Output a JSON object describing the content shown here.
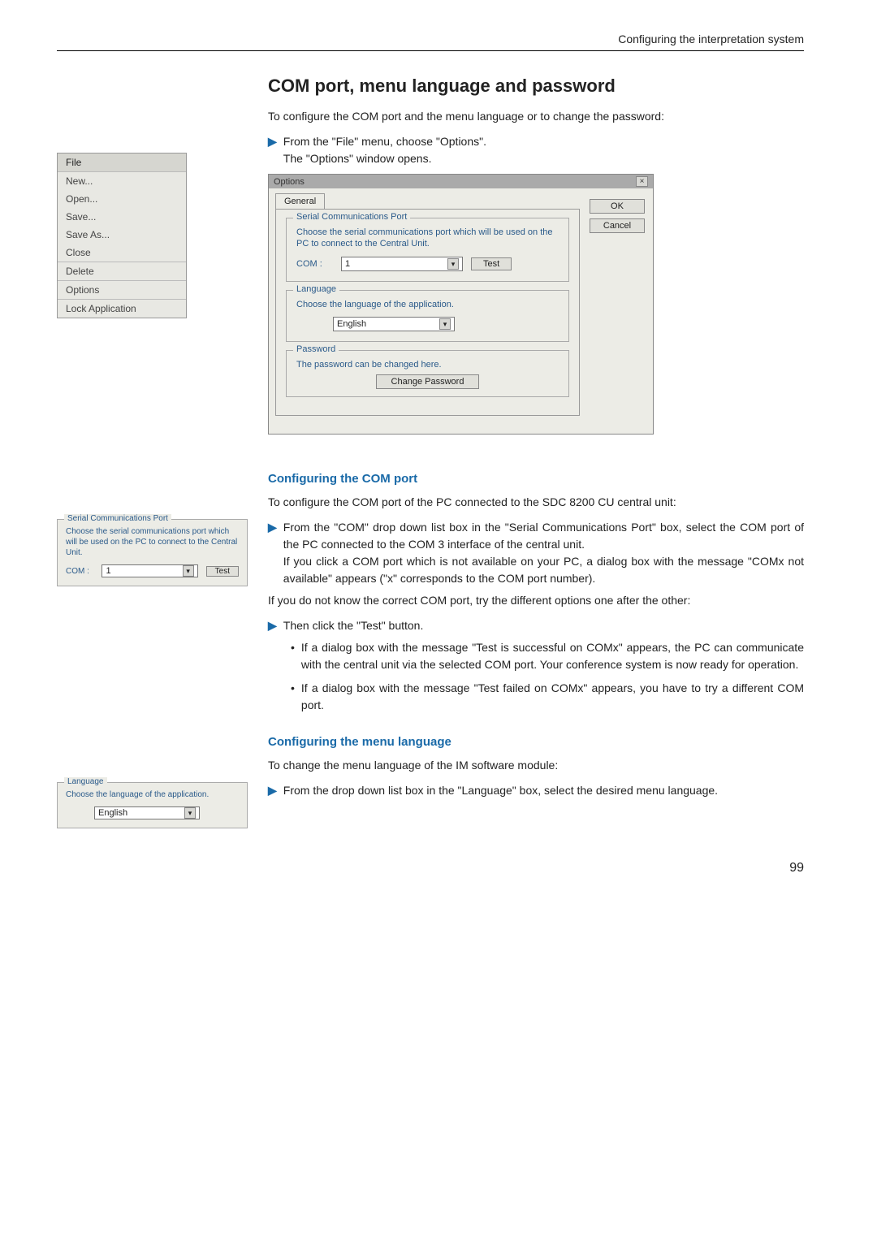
{
  "header": {
    "running_head": "Configuring the interpretation system"
  },
  "section": {
    "title": "COM port, menu language and password"
  },
  "intro": {
    "p1": "To configure the COM port and the menu language or to change the password:",
    "step1_a": "From the \"File\" menu, choose \"Options\".",
    "step1_b": "The \"Options\" window opens."
  },
  "file_menu": {
    "title": "File",
    "items": [
      "New...",
      "Open...",
      "Save...",
      "Save As...",
      "Close",
      "Delete",
      "Options",
      "Lock Application"
    ]
  },
  "dialog": {
    "title": "Options",
    "tab": "General",
    "ok": "OK",
    "cancel": "Cancel",
    "serial": {
      "legend": "Serial Communications Port",
      "help": "Choose the serial communications port which will be used on the PC to connect to the Central Unit.",
      "label": "COM :",
      "value": "1",
      "test": "Test"
    },
    "language": {
      "legend": "Language",
      "help": "Choose the language of the application.",
      "value": "English"
    },
    "password": {
      "legend": "Password",
      "help": "The password can be changed here.",
      "button": "Change Password"
    }
  },
  "comport": {
    "heading": "Configuring the COM port",
    "p1": "To configure the COM port of the PC connected to the SDC 8200 CU central unit:",
    "step1": "From the \"COM\" drop down list box in the \"Serial Communications Port\" box, select the COM port of the PC connected to the COM 3 interface of the central unit.",
    "step1_note": "If you click a COM port which is not available on your PC, a dialog box with the message \"COMx not available\" appears (\"x\" corresponds to the COM port number).",
    "p2": "If you do not know the correct COM port, try the different options one after the other:",
    "step2": "Then click the \"Test\" button.",
    "bullet1": "If a dialog box with the message \"Test is successful on COMx\" appears, the PC can communicate with the central unit via the selected COM port. Your conference system is now ready for operation.",
    "bullet2": "If a dialog box with the message \"Test failed on COMx\" appears, you have to try a different COM port."
  },
  "menulang": {
    "heading": "Configuring the menu language",
    "p1": "To change the menu language of the IM software module:",
    "step1": "From the drop down list box in the \"Language\" box, select the desired menu language."
  },
  "page_number": "99"
}
